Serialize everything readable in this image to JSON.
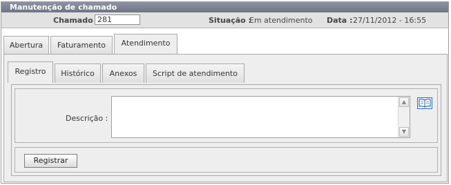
{
  "window": {
    "title": "Manutenção de chamado"
  },
  "info": {
    "chamado_label": "Chamado :",
    "chamado_value": "281",
    "situacao_label": "Situação :",
    "situacao_value": "Em atendimento",
    "data_label": "Data :",
    "data_value": "27/11/2012 - 16:55"
  },
  "outer_tabs": [
    "Abertura",
    "Faturamento",
    "Atendimento"
  ],
  "outer_active": "Atendimento",
  "inner_tabs": [
    "Registro",
    "Histórico",
    "Anexos",
    "Script de atendimento"
  ],
  "inner_active": "Registro",
  "form": {
    "descricao_label": "Descrição :",
    "descricao_value": "",
    "book_icon": "open-book-icon",
    "submit_label": "Registrar"
  },
  "colors": {
    "titlebar": "#7a7f92",
    "infobar": "#e2e2e2",
    "panel": "#eeeeee",
    "book": "#2b6fc1"
  }
}
